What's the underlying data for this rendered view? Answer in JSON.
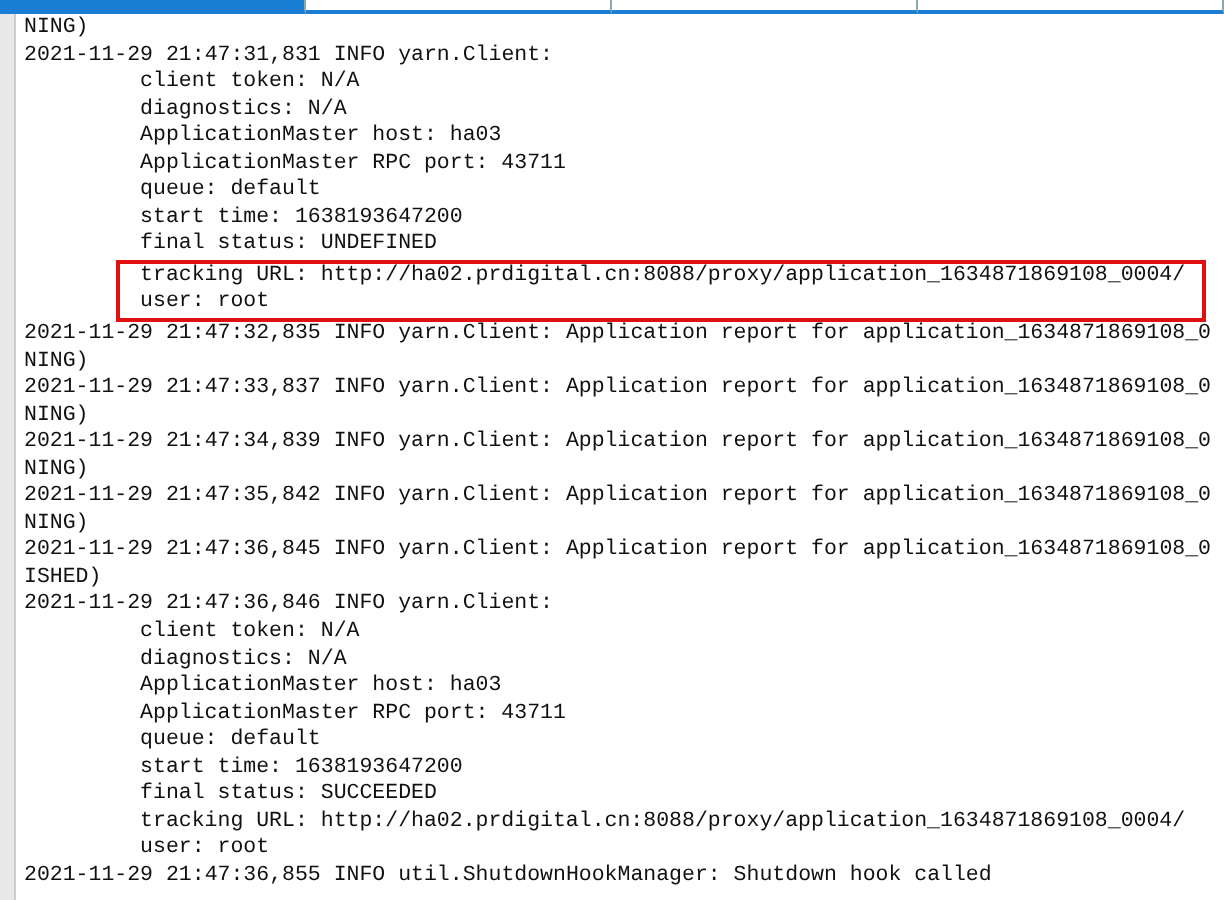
{
  "tabs": [
    {
      "selected": true
    },
    {
      "selected": false
    },
    {
      "selected": false
    },
    {
      "selected": false
    }
  ],
  "log_lines": [
    {
      "kind": "wrap",
      "text": "NING)",
      "highlighted": false
    },
    {
      "kind": "entry",
      "text": "2021-11-29 21:47:31,831 INFO yarn.Client:",
      "highlighted": false
    },
    {
      "kind": "detail",
      "text": "client token: N/A",
      "highlighted": false
    },
    {
      "kind": "detail",
      "text": "diagnostics: N/A",
      "highlighted": false
    },
    {
      "kind": "detail",
      "text": "ApplicationMaster host: ha03",
      "highlighted": false
    },
    {
      "kind": "detail",
      "text": "ApplicationMaster RPC port: 43711",
      "highlighted": false
    },
    {
      "kind": "detail",
      "text": "queue: default",
      "highlighted": false
    },
    {
      "kind": "detail",
      "text": "start time: 1638193647200",
      "highlighted": false
    },
    {
      "kind": "detail",
      "text": "final status: UNDEFINED",
      "highlighted": false
    },
    {
      "kind": "detail",
      "text": "tracking URL: http://ha02.prdigital.cn:8088/proxy/application_1634871869108_0004/",
      "highlighted": true
    },
    {
      "kind": "detail",
      "text": "user: root",
      "highlighted": true
    },
    {
      "kind": "entry",
      "text": "2021-11-29 21:47:32,835 INFO yarn.Client: Application report for application_1634871869108_0",
      "highlighted": false
    },
    {
      "kind": "wrap",
      "text": "NING)",
      "highlighted": false
    },
    {
      "kind": "entry",
      "text": "2021-11-29 21:47:33,837 INFO yarn.Client: Application report for application_1634871869108_0",
      "highlighted": false
    },
    {
      "kind": "wrap",
      "text": "NING)",
      "highlighted": false
    },
    {
      "kind": "entry",
      "text": "2021-11-29 21:47:34,839 INFO yarn.Client: Application report for application_1634871869108_0",
      "highlighted": false
    },
    {
      "kind": "wrap",
      "text": "NING)",
      "highlighted": false
    },
    {
      "kind": "entry",
      "text": "2021-11-29 21:47:35,842 INFO yarn.Client: Application report for application_1634871869108_0",
      "highlighted": false
    },
    {
      "kind": "wrap",
      "text": "NING)",
      "highlighted": false
    },
    {
      "kind": "entry",
      "text": "2021-11-29 21:47:36,845 INFO yarn.Client: Application report for application_1634871869108_0",
      "highlighted": false
    },
    {
      "kind": "wrap",
      "text": "ISHED)",
      "highlighted": false
    },
    {
      "kind": "entry",
      "text": "2021-11-29 21:47:36,846 INFO yarn.Client:",
      "highlighted": false
    },
    {
      "kind": "detail",
      "text": "client token: N/A",
      "highlighted": false
    },
    {
      "kind": "detail",
      "text": "diagnostics: N/A",
      "highlighted": false
    },
    {
      "kind": "detail",
      "text": "ApplicationMaster host: ha03",
      "highlighted": false
    },
    {
      "kind": "detail",
      "text": "ApplicationMaster RPC port: 43711",
      "highlighted": false
    },
    {
      "kind": "detail",
      "text": "queue: default",
      "highlighted": false
    },
    {
      "kind": "detail",
      "text": "start time: 1638193647200",
      "highlighted": false
    },
    {
      "kind": "detail",
      "text": "final status: SUCCEEDED",
      "highlighted": false
    },
    {
      "kind": "detail",
      "text": "tracking URL: http://ha02.prdigital.cn:8088/proxy/application_1634871869108_0004/",
      "highlighted": false
    },
    {
      "kind": "detail",
      "text": "user: root",
      "highlighted": false
    },
    {
      "kind": "entry",
      "text": "2021-11-29 21:47:36,855 INFO util.ShutdownHookManager: Shutdown hook called",
      "highlighted": false
    }
  ]
}
